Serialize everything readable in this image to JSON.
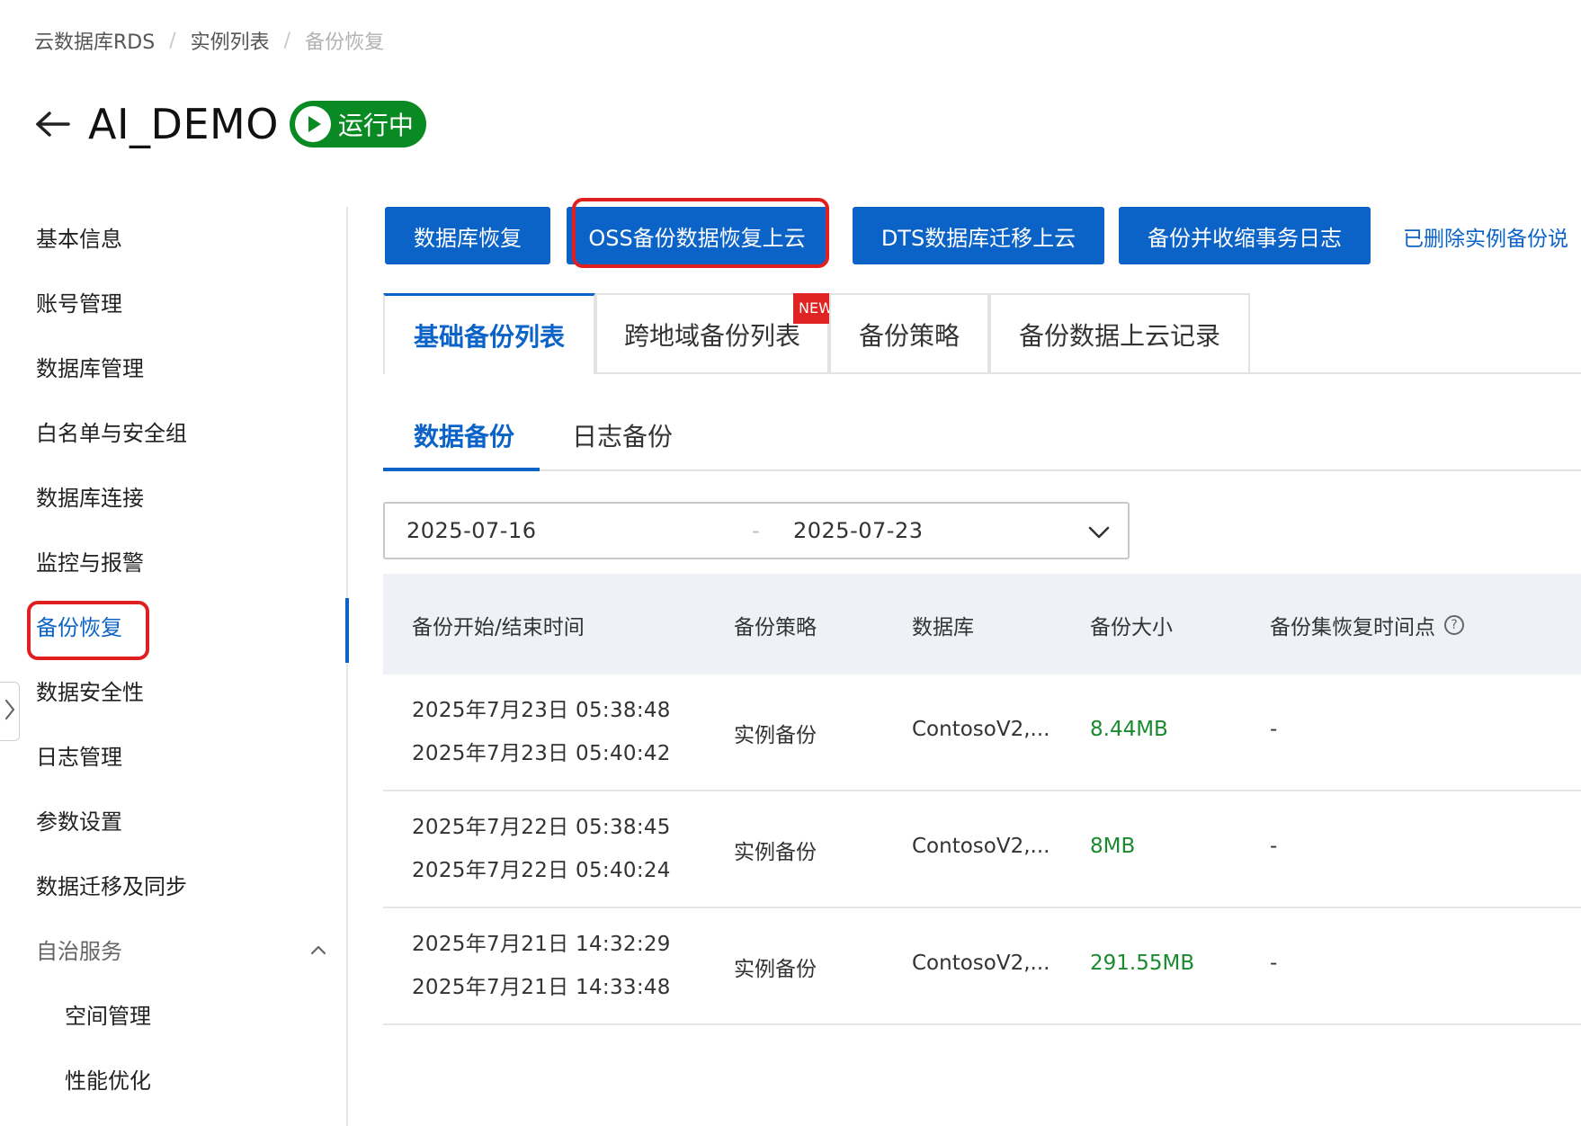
{
  "breadcrumb": {
    "items": [
      "云数据库RDS",
      "实例列表",
      "备份恢复"
    ],
    "separator": "/"
  },
  "header": {
    "title": "AI_DEMO",
    "status": "运行中",
    "status_color": "#0a8a23"
  },
  "sidebar": {
    "items": [
      {
        "label": "基本信息"
      },
      {
        "label": "账号管理"
      },
      {
        "label": "数据库管理"
      },
      {
        "label": "白名单与安全组"
      },
      {
        "label": "数据库连接"
      },
      {
        "label": "监控与报警"
      },
      {
        "label": "备份恢复",
        "active": true
      },
      {
        "label": "数据安全性"
      },
      {
        "label": "日志管理"
      },
      {
        "label": "参数设置"
      },
      {
        "label": "数据迁移及同步"
      },
      {
        "label": "自治服务",
        "expanded": true
      },
      {
        "label": "空间管理"
      },
      {
        "label": "性能优化"
      }
    ],
    "active_color": "#0c63c7"
  },
  "toolbar": {
    "buttons": [
      "数据库恢复",
      "OSS备份数据恢复上云",
      "DTS数据库迁移上云",
      "备份并收缩事务日志"
    ],
    "link": "已删除实例备份说",
    "accent": "#0c63c7"
  },
  "tabs": {
    "items": [
      "基础备份列表",
      "跨地域备份列表",
      "备份策略",
      "备份数据上云记录"
    ],
    "active": "基础备份列表",
    "new_badge": "NEW"
  },
  "subtabs": {
    "items": [
      "数据备份",
      "日志备份"
    ],
    "active": "数据备份"
  },
  "date_range": {
    "start": "2025-07-16",
    "separator": "-",
    "end": "2025-07-23"
  },
  "table": {
    "columns": [
      "备份开始/结束时间",
      "备份策略",
      "数据库",
      "备份大小",
      "备份集恢复时间点"
    ],
    "rows": [
      {
        "start": "2025年7月23日 05:38:48",
        "end": "2025年7月23日 05:40:42",
        "policy": "实例备份",
        "database": "ContosoV2,...",
        "size": "8.44MB",
        "restore_point": "-"
      },
      {
        "start": "2025年7月22日 05:38:45",
        "end": "2025年7月22日 05:40:24",
        "policy": "实例备份",
        "database": "ContosoV2,...",
        "size": "8MB",
        "restore_point": "-"
      },
      {
        "start": "2025年7月21日 14:32:29",
        "end": "2025年7月21日 14:33:48",
        "policy": "实例备份",
        "database": "ContosoV2,...",
        "size": "291.55MB",
        "restore_point": "-"
      }
    ],
    "size_color": "#1a8a2f"
  },
  "icons": {
    "back": "arrow-left-icon",
    "status": "play-circle-icon",
    "date_dropdown": "chevron-down-icon",
    "group_toggle": "chevron-up-icon",
    "help": "question-circle-icon",
    "sidebar_collapse": "chevron-right-icon"
  }
}
